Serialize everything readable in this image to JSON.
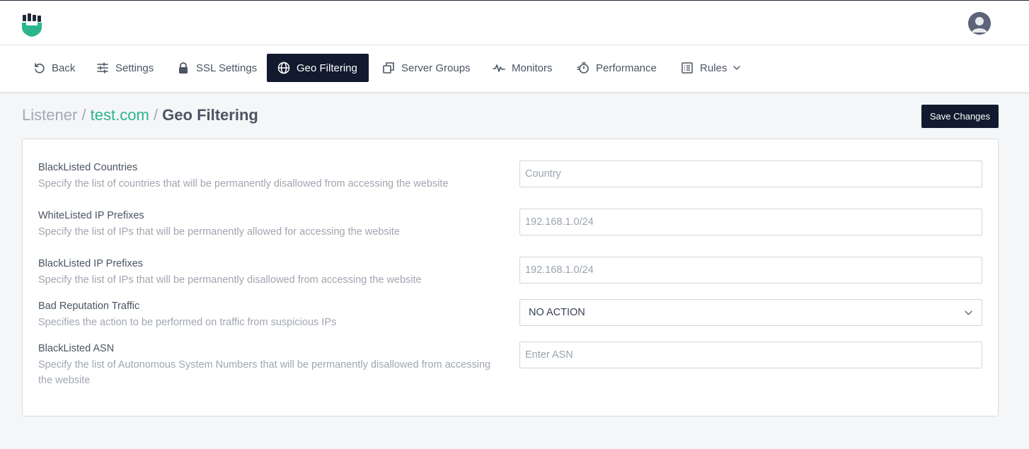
{
  "nav": {
    "items": [
      {
        "label": "Back",
        "icon": "undo-icon"
      },
      {
        "label": "Settings",
        "icon": "sliders-icon"
      },
      {
        "label": "SSL Settings",
        "icon": "lock-icon"
      },
      {
        "label": "Geo Filtering",
        "icon": "globe-icon",
        "active": true
      },
      {
        "label": "Server Groups",
        "icon": "copy-icon"
      },
      {
        "label": "Monitors",
        "icon": "pulse-icon"
      },
      {
        "label": "Performance",
        "icon": "stopwatch-icon"
      },
      {
        "label": "Rules",
        "icon": "list-icon",
        "has_dropdown": true
      }
    ]
  },
  "breadcrumb": {
    "root": "Listener",
    "separator": "/",
    "site": "test.com",
    "current": "Geo Filtering"
  },
  "actions": {
    "save_label": "Save Changes"
  },
  "form": {
    "fields": [
      {
        "label": "BlackListed Countries",
        "description": "Specify the list of countries that will be permanently disallowed from accessing the website",
        "placeholder": "Country"
      },
      {
        "label": "WhiteListed IP Prefixes",
        "description": "Specify the list of IPs that will be permanently allowed for accessing the website",
        "placeholder": "192.168.1.0/24"
      },
      {
        "label": "BlackListed IP Prefixes",
        "description": "Specify the list of IPs that will be permanently disallowed from accessing the website",
        "placeholder": "192.168.1.0/24"
      },
      {
        "label": "Bad Reputation Traffic",
        "description": "Specifies the action to be performed on traffic from suspicious IPs",
        "selected": "NO ACTION"
      },
      {
        "label": "BlackListed ASN",
        "description": "Specify the list of Autonomous System Numbers that will be permanently disallowed from accessing the website",
        "placeholder": "Enter ASN"
      }
    ]
  },
  "colors": {
    "primary_dark": "#111a2e",
    "accent_green": "#2bb58f"
  }
}
